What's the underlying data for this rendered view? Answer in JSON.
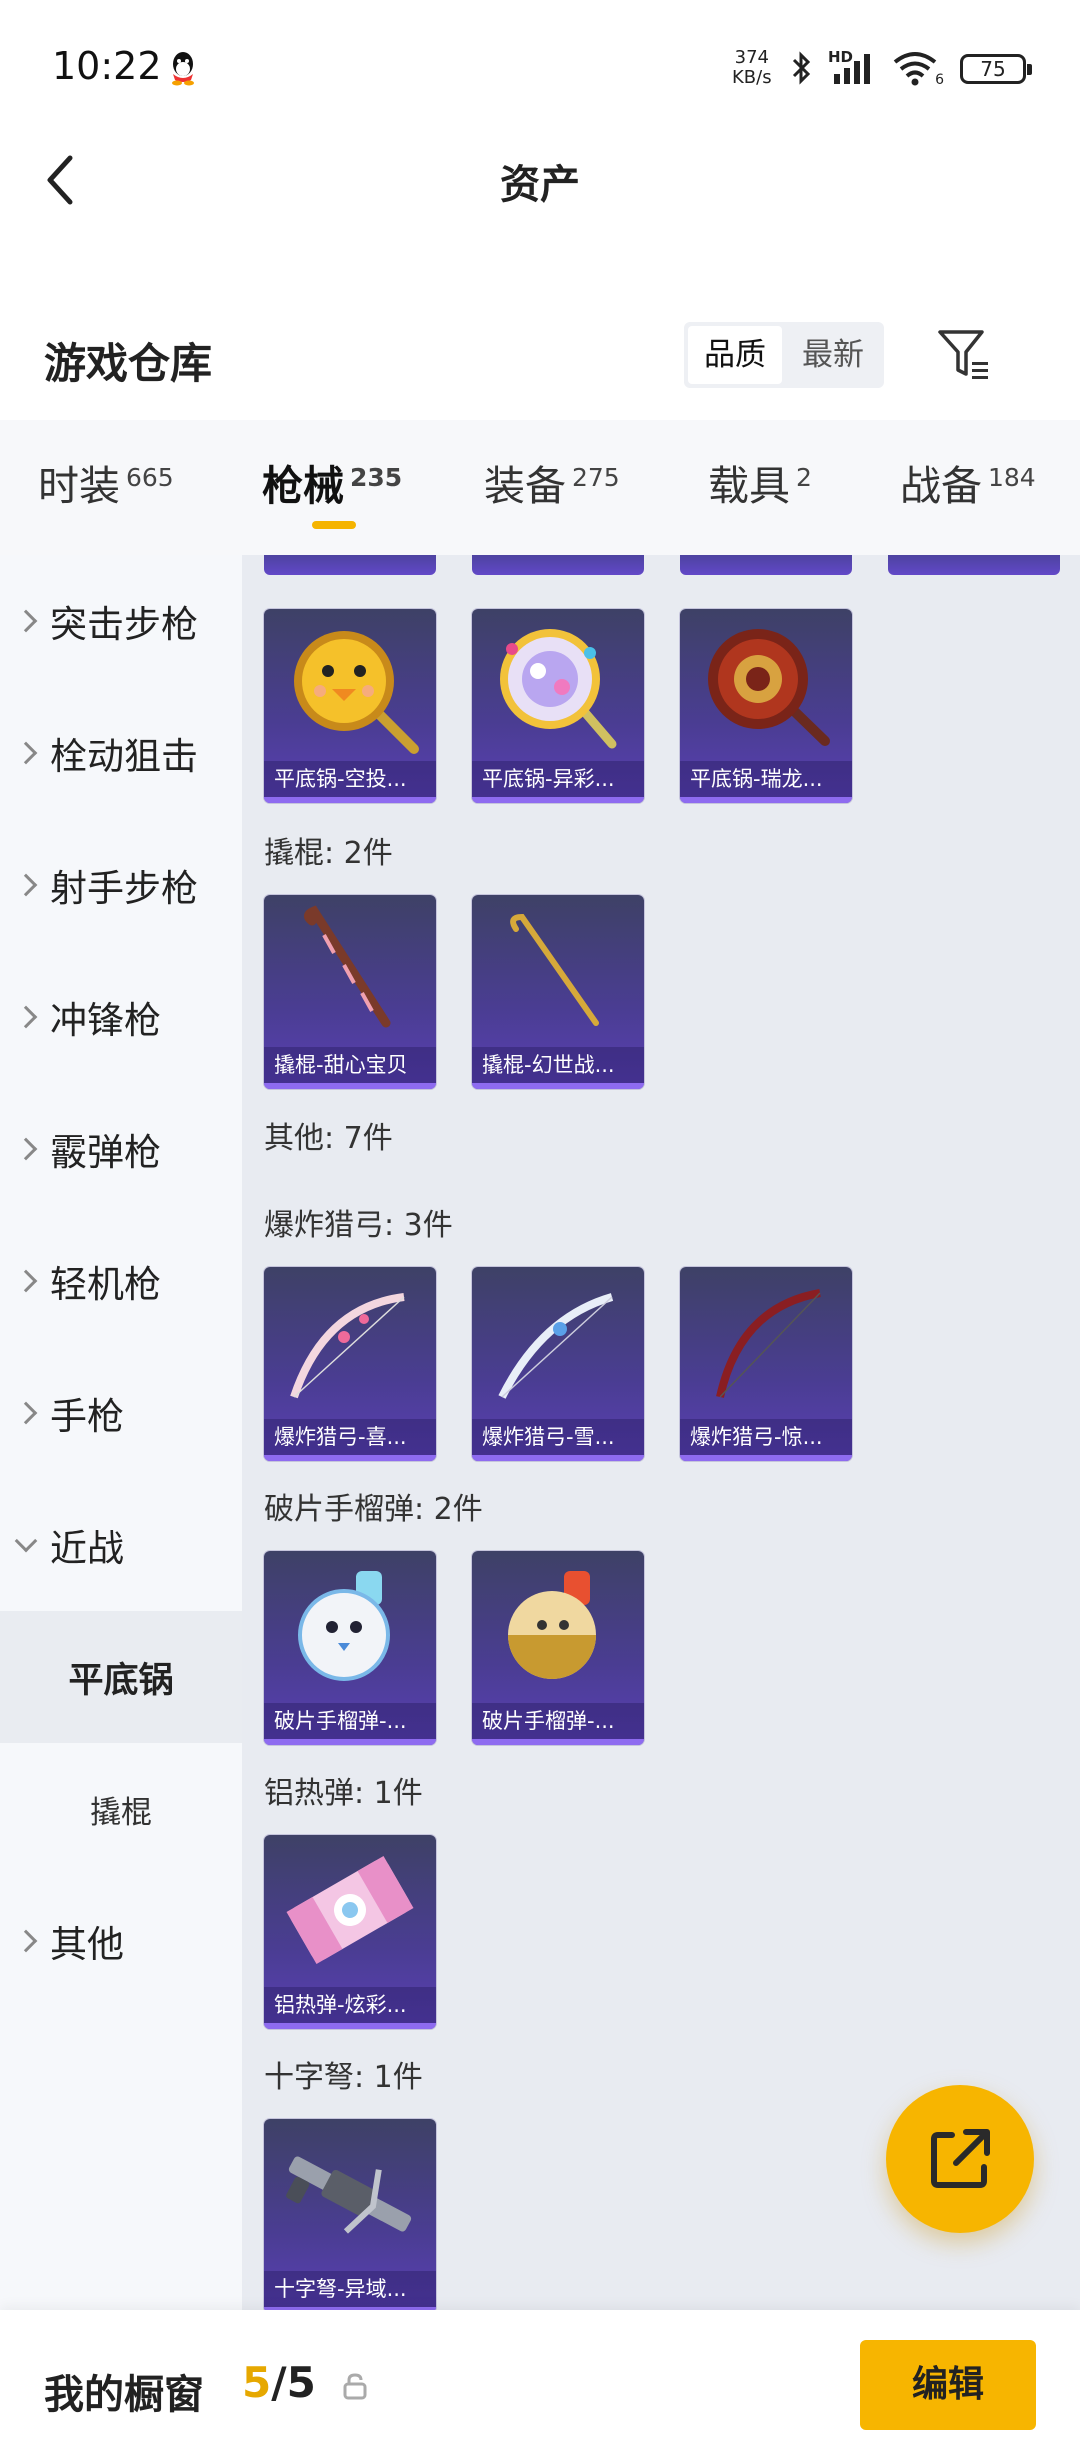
{
  "status_bar": {
    "time": "10:22",
    "net_speed_value": "374",
    "net_speed_unit": "KB/s",
    "hd_label": "HD",
    "wifi_label": "6",
    "battery": "75"
  },
  "header": {
    "title": "资产"
  },
  "warehouse": {
    "title": "游戏仓库",
    "sort_quality": "品质",
    "sort_latest": "最新"
  },
  "tabs": [
    {
      "label": "时装",
      "count": "665"
    },
    {
      "label": "枪械",
      "count": "235"
    },
    {
      "label": "装备",
      "count": "275"
    },
    {
      "label": "载具",
      "count": "2"
    },
    {
      "label": "战备",
      "count": "184"
    }
  ],
  "sidebar": [
    {
      "label": "突击步枪"
    },
    {
      "label": "栓动狙击"
    },
    {
      "label": "射手步枪"
    },
    {
      "label": "冲锋枪"
    },
    {
      "label": "霰弹枪"
    },
    {
      "label": "轻机枪"
    },
    {
      "label": "手枪"
    },
    {
      "label": "近战"
    },
    {
      "label": "平底锅"
    },
    {
      "label": "撬棍"
    },
    {
      "label": "其他"
    }
  ],
  "sections": {
    "pan_items": [
      "平底锅-空投...",
      "平底锅-异彩...",
      "平底锅-瑞龙..."
    ],
    "crowbar_header": "撬棍: 2件",
    "crowbar_items": [
      "撬棍-甜心宝贝",
      "撬棍-幻世战..."
    ],
    "other_header": "其他: 7件",
    "bow_header": "爆炸猎弓: 3件",
    "bow_items": [
      "爆炸猎弓-喜...",
      "爆炸猎弓-雪...",
      "爆炸猎弓-惊..."
    ],
    "grenade_header": "破片手榴弹: 2件",
    "grenade_items": [
      "破片手榴弹-...",
      "破片手榴弹-..."
    ],
    "thermite_header": "铝热弹: 1件",
    "thermite_items": [
      "铝热弹-炫彩..."
    ],
    "crossbow_header": "十字弩: 1件",
    "crossbow_items": [
      "十字弩-异域..."
    ]
  },
  "bottom": {
    "label": "我的橱窗",
    "used": "5",
    "sep": "/",
    "total": "5",
    "edit_label": "编辑"
  },
  "colors": {
    "accent": "#f7b500",
    "card_bg": "#4a3d92"
  }
}
